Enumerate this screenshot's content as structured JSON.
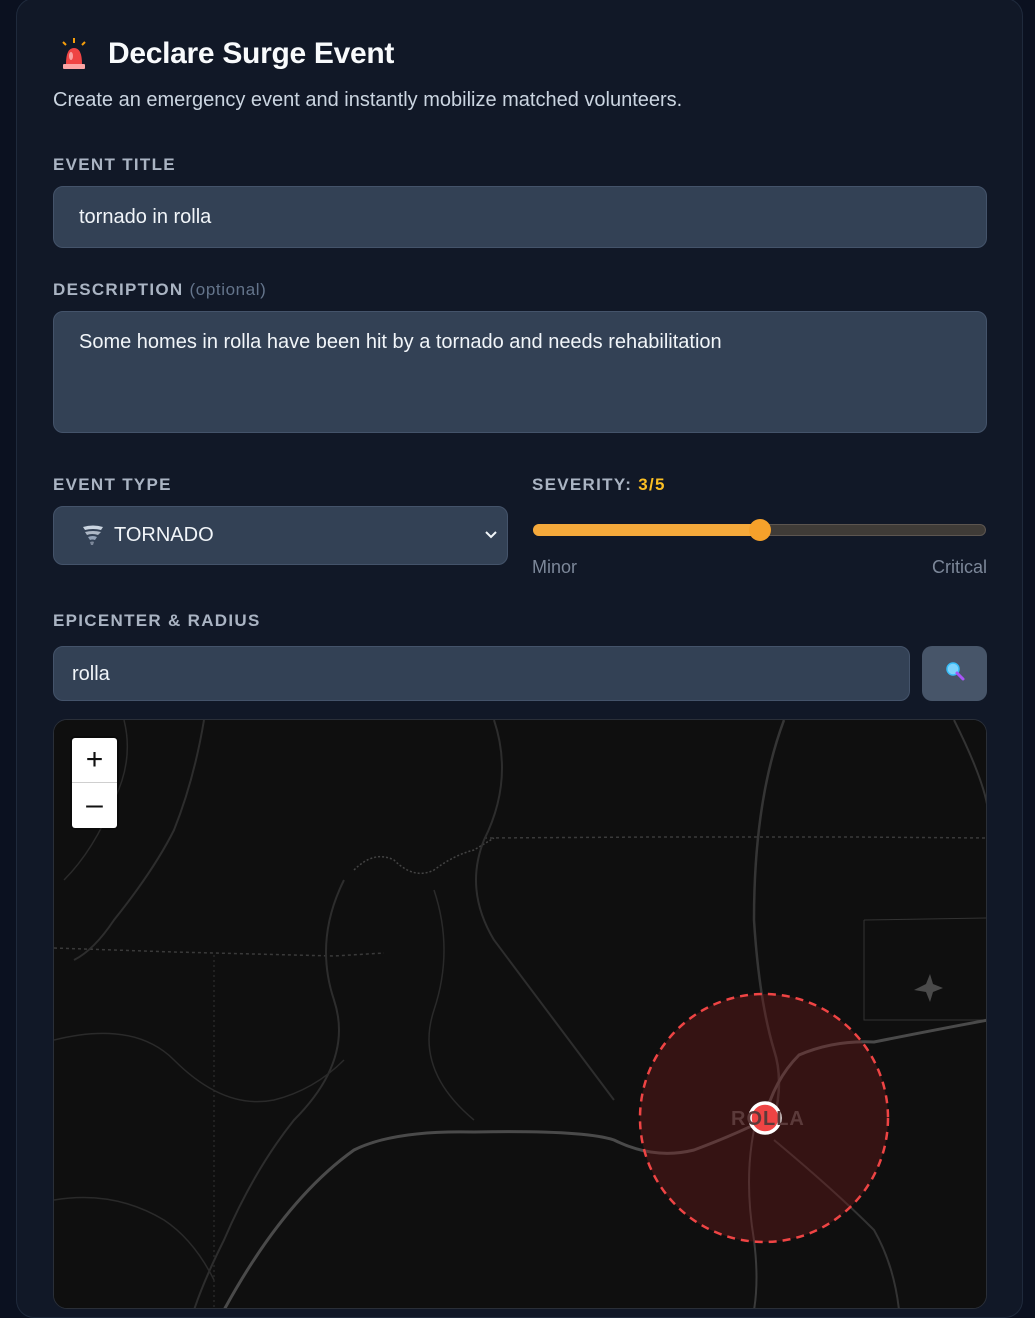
{
  "header": {
    "title": "Declare Surge Event",
    "subtitle": "Create an emergency event and instantly mobilize matched volunteers.",
    "icon": "siren-icon"
  },
  "form": {
    "event_title_label": "EVENT TITLE",
    "event_title_value": "tornado in rolla",
    "description_label": "DESCRIPTION",
    "description_optional": "(optional)",
    "description_value": "Some homes in rolla have been hit by a tornado and needs rehabilitation",
    "event_type_label": "EVENT TYPE",
    "event_type_value": "TORNADO",
    "event_type_icon": "tornado-icon",
    "severity_label": "SEVERITY:",
    "severity_value": "3/5",
    "severity_level": 3,
    "severity_max": 5,
    "severity_min_label": "Minor",
    "severity_max_label": "Critical",
    "epicenter_label": "EPICENTER & RADIUS",
    "epicenter_value": "rolla",
    "search_icon": "search-icon"
  },
  "map": {
    "zoom_in": "+",
    "zoom_out": "–",
    "town_label": "ROLLA",
    "marker_color": "#ef4444"
  },
  "colors": {
    "accent_orange": "#f5a93b",
    "severity_text": "#fbbf24",
    "card_bg": "#111827",
    "field_bg": "#334155"
  }
}
